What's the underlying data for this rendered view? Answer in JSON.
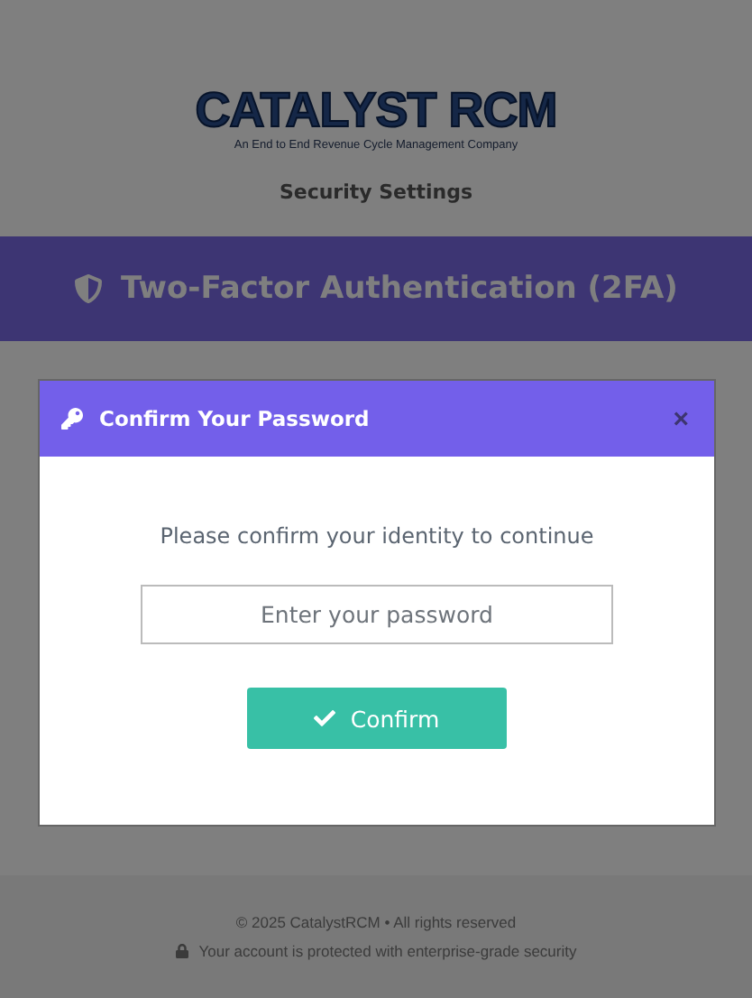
{
  "logo": {
    "name": "CATALYST RCM",
    "tagline": "An End to End Revenue Cycle Management Company"
  },
  "page_title": "Security Settings",
  "banner": {
    "title": "Two-Factor Authentication (2FA)"
  },
  "modal": {
    "title": "Confirm Your Password",
    "close": "×",
    "message": "Please confirm your identity to continue",
    "password_field": {
      "placeholder": "Enter your password"
    },
    "confirm_button": "Confirm"
  },
  "footer": {
    "copyright": "© 2025 CatalystRCM • All rights reserved",
    "security_note": "Your account is protected with enterprise-grade security"
  }
}
